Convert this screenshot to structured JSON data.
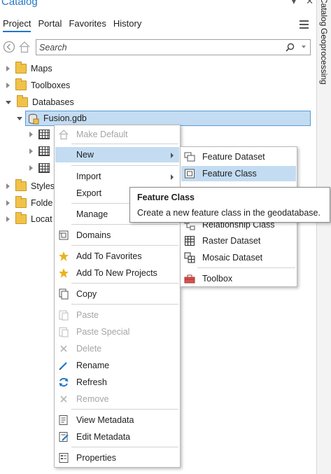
{
  "pane": {
    "title": "Catalog",
    "tabs": [
      {
        "label": "Project",
        "active": true
      },
      {
        "label": "Portal",
        "active": false
      },
      {
        "label": "Favorites",
        "active": false
      },
      {
        "label": "History",
        "active": false
      }
    ],
    "search_placeholder": "Search"
  },
  "tree": {
    "items": [
      {
        "label": "Maps"
      },
      {
        "label": "Toolboxes"
      },
      {
        "label": "Databases"
      },
      {
        "label": "Fusion.gdb"
      },
      {
        "label": "Styles"
      },
      {
        "label": "Folde"
      },
      {
        "label": "Locat"
      }
    ]
  },
  "side_tabs": [
    "Catalog",
    "Geoprocessing"
  ],
  "context_menu": {
    "items": [
      {
        "label": "Make Default",
        "enabled": false
      },
      {
        "label": "New",
        "enabled": true,
        "submenu": true
      },
      {
        "label": "Import",
        "enabled": true,
        "submenu": true
      },
      {
        "label": "Export",
        "enabled": true,
        "submenu": true
      },
      {
        "label": "Manage",
        "enabled": true
      },
      {
        "label": "Domains",
        "enabled": true
      },
      {
        "label": "Add To Favorites",
        "enabled": true
      },
      {
        "label": "Add To New Projects",
        "enabled": true
      },
      {
        "label": "Copy",
        "enabled": true
      },
      {
        "label": "Paste",
        "enabled": false
      },
      {
        "label": "Paste Special",
        "enabled": false
      },
      {
        "label": "Delete",
        "enabled": false
      },
      {
        "label": "Rename",
        "enabled": true
      },
      {
        "label": "Refresh",
        "enabled": true
      },
      {
        "label": "Remove",
        "enabled": false
      },
      {
        "label": "View Metadata",
        "enabled": true
      },
      {
        "label": "Edit Metadata",
        "enabled": true
      },
      {
        "label": "Properties",
        "enabled": true
      }
    ]
  },
  "submenu": {
    "items": [
      {
        "label": "Feature Dataset"
      },
      {
        "label": "Feature Class",
        "highlighted": true
      },
      {
        "label": "Relationship Class"
      },
      {
        "label": "Raster Dataset"
      },
      {
        "label": "Mosaic Dataset"
      },
      {
        "label": "Toolbox"
      }
    ]
  },
  "tooltip": {
    "title": "Feature Class",
    "body": "Create a new feature class in the geodatabase."
  },
  "colors": {
    "accent": "#1f77c8",
    "selection": "#c3dcf2",
    "folder": "#f0c348",
    "star": "#e8b320",
    "refresh": "#1f77c8"
  }
}
